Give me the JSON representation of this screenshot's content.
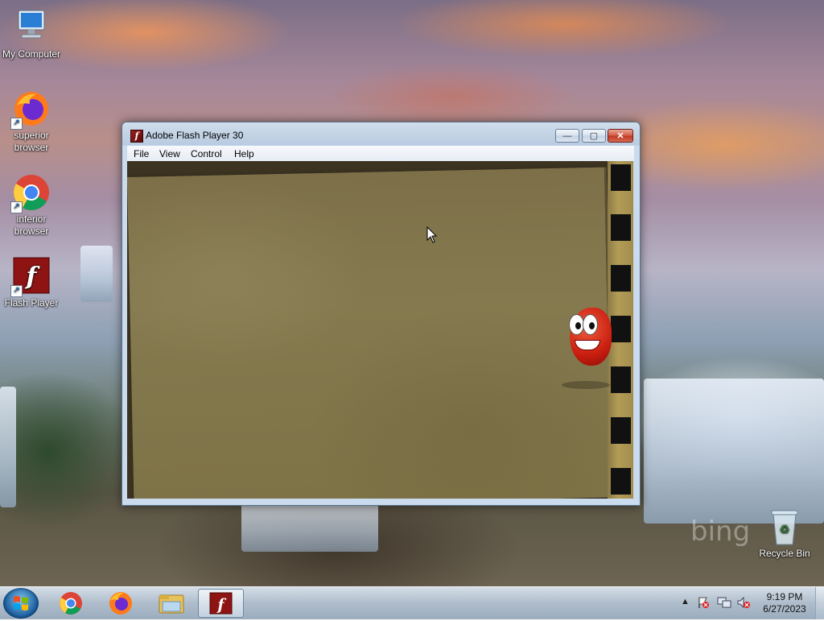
{
  "desktop": {
    "icons": [
      {
        "label": "My Computer",
        "icon": "my-computer-icon"
      },
      {
        "label": "superior\nbrowser",
        "icon": "firefox-icon"
      },
      {
        "label": "inferior\nbrowser",
        "icon": "chrome-icon"
      },
      {
        "label": "Flash Player",
        "icon": "flash-player-icon"
      },
      {
        "label": "Recycle Bin",
        "icon": "recycle-bin-icon"
      }
    ],
    "watermark": "bing"
  },
  "window": {
    "title": "Adobe Flash Player 30",
    "menu": [
      "File",
      "View",
      "Control",
      "Help"
    ],
    "controls": {
      "minimize": "—",
      "maximize": "▢",
      "close": "✕"
    }
  },
  "taskbar": {
    "pinned": [
      "chrome-icon",
      "firefox-icon",
      "file-explorer-icon",
      "flash-player-icon"
    ],
    "active": "flash-player-icon",
    "tray_icons": [
      "show-hidden-icons-icon",
      "action-center-flag-icon",
      "network-icon",
      "volume-muted-icon"
    ],
    "tray_arrow": "▲",
    "time": "9:19 PM",
    "date": "6/27/2023"
  },
  "colors": {
    "flash_red": "#8e1414",
    "paper": "#7f7349",
    "film_strip": "#a28d4e"
  }
}
